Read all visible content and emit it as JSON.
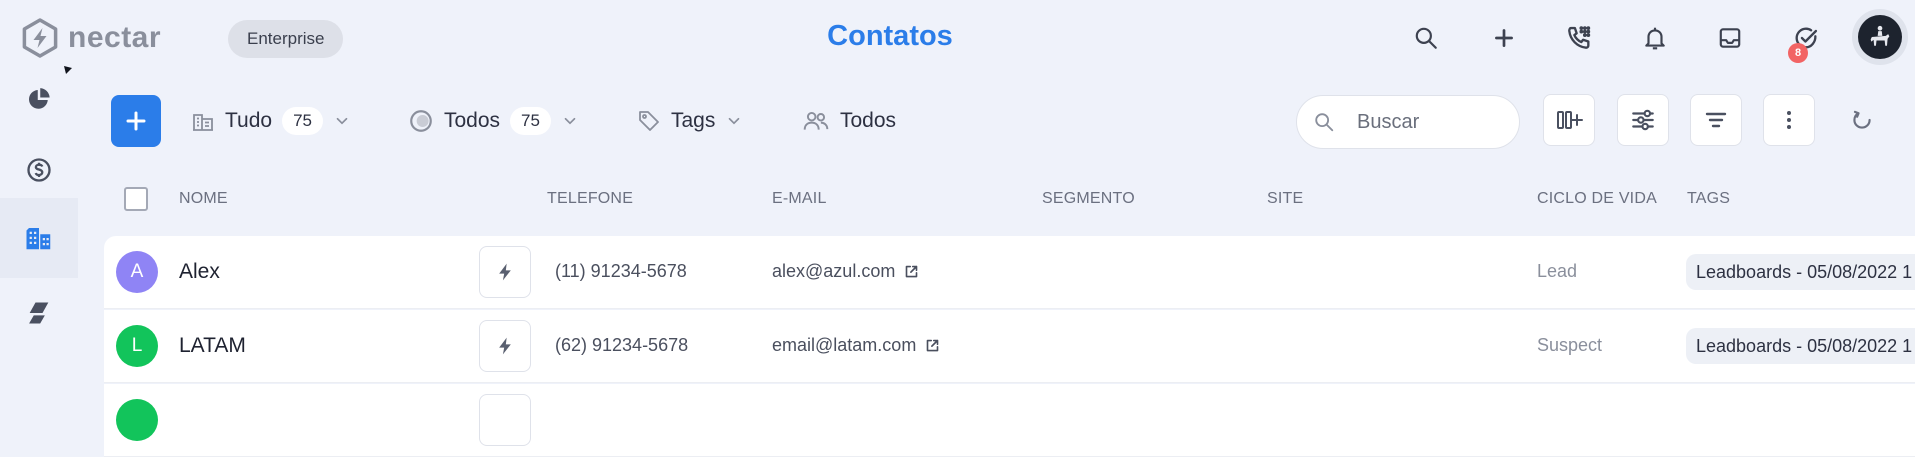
{
  "header": {
    "brand": "nectar",
    "plan": "Enterprise",
    "title": "Contatos",
    "icons": [
      "search-icon",
      "plus-icon",
      "dialpad-phone-icon",
      "bell-icon",
      "inbox-icon",
      "check-circle-icon"
    ],
    "notification_count": "8"
  },
  "sidebar": {
    "items": [
      "pie-chart-icon",
      "dollar-circle-icon",
      "buildings-icon",
      "layers-icon"
    ],
    "active": "buildings-icon"
  },
  "toolbar": {
    "filters": [
      {
        "icon": "building-icon",
        "label": "Tudo",
        "count": "75"
      },
      {
        "icon": "status-ring-icon",
        "label": "Todos",
        "count": "75"
      },
      {
        "icon": "tag-icon",
        "label": "Tags"
      },
      {
        "icon": "users-icon",
        "label": "Todos"
      }
    ],
    "search_placeholder": "Buscar",
    "buttons": [
      "add-column-icon",
      "sliders-icon",
      "sort-icon",
      "more-vertical-icon",
      "refresh-icon"
    ]
  },
  "table": {
    "columns": [
      "NOME",
      "TELEFONE",
      "E-MAIL",
      "SEGMENTO",
      "SITE",
      "CICLO DE VIDA",
      "TAGS"
    ],
    "rows": [
      {
        "initial": "A",
        "name": "Alex",
        "phone": "(11) 91234-5678",
        "email": "alex@azul.com",
        "segment": "",
        "site": "",
        "lifecycle": "Lead",
        "tag": "Leadboards - 05/08/2022 1"
      },
      {
        "initial": "L",
        "name": "LATAM",
        "phone": "(62) 91234-5678",
        "email": "email@latam.com",
        "segment": "",
        "site": "",
        "lifecycle": "Suspect",
        "tag": "Leadboards - 05/08/2022 1"
      }
    ]
  },
  "colors": {
    "accent": "#2b7de9",
    "background": "#eff2fa",
    "avatar_a": "#8f84f5",
    "avatar_l": "#12c45b",
    "badge": "#f26464"
  }
}
